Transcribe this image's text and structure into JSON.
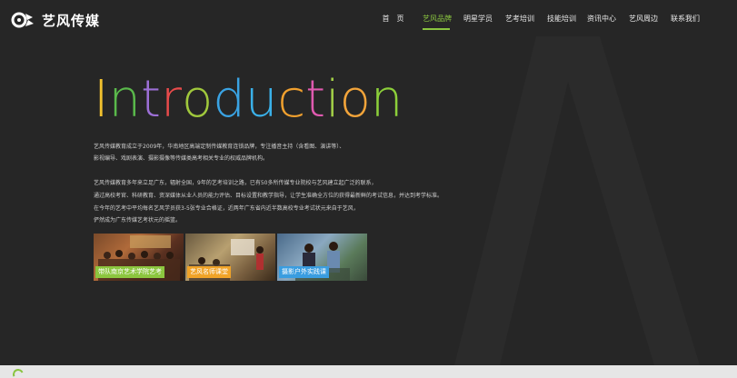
{
  "brand": {
    "logo_name": "艺风传媒",
    "logo_icon": "yifeng-logo-icon",
    "accent_color": "#89c440"
  },
  "nav": {
    "items": [
      {
        "label": "首　页",
        "active": false
      },
      {
        "label": "艺风品牌",
        "active": true
      },
      {
        "label": "明星学员",
        "active": false
      },
      {
        "label": "艺考培训",
        "active": false
      },
      {
        "label": "技能培训",
        "active": false
      },
      {
        "label": "资讯中心",
        "active": false
      },
      {
        "label": "艺风周边",
        "active": false
      },
      {
        "label": "联系我们",
        "active": false
      }
    ]
  },
  "intro": {
    "title": "Introduction",
    "letter_colors": [
      "#f2c12e",
      "#5ab94b",
      "#9c6fd6",
      "#e94b4b",
      "#a0c83c",
      "#3aa3e3",
      "#3ab0e8",
      "#f0a02e",
      "#e05ab0",
      "#a3d047",
      "#f2a43a",
      "#8ccf3a"
    ],
    "paragraphs": [
      "艺风传媒教育成立于2009年，华南地区高端定制传媒教育连锁品牌，专注播音主持（含看图、演讲等）、",
      "影视编导、戏剧表演、摄影摄像等传媒类高考相关专业的权威品牌机构。",
      "艺风传媒教育多年来立足广东，辐射全国，9年的艺考培训之路，已有50多所传媒专业院校与艺风建立起广泛的联系，",
      "通过高校考官、科研教育、资深媒体从业人员的能力评估、目标设置和教学指导，让学生准确全方位的获得最新鲜的考试信息，并达到考学标准。",
      "在今年的艺考中平均每名艺风学员获3-5张专业合格证，近两年广东省内近半数高校专业考试状元来自于艺风，",
      "俨然成为广东传媒艺考状元的摇篮。"
    ]
  },
  "photos": [
    {
      "label": "带队南京艺术学院艺考",
      "label_color": "#8cc63f"
    },
    {
      "label": "艺风名师课堂",
      "label_color": "#f0a328"
    },
    {
      "label": "摄影户外实践课",
      "label_color": "#3a9de0"
    }
  ]
}
